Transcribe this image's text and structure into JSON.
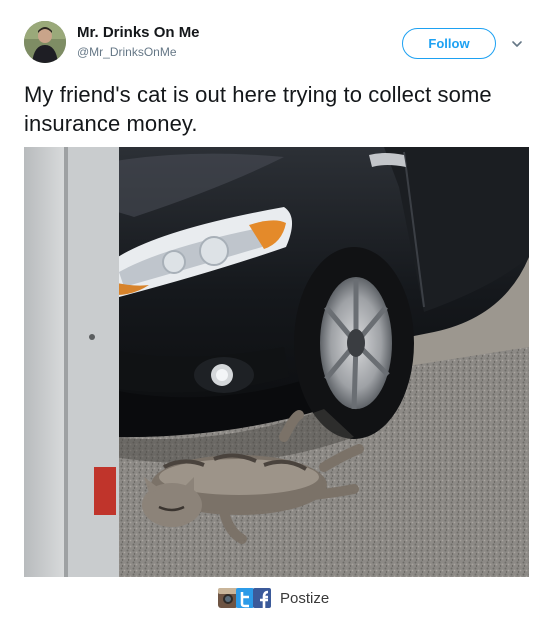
{
  "tweet": {
    "author": {
      "display_name": "Mr. Drinks On Me",
      "handle": "@Mr_DrinksOnMe",
      "avatar_icon": "avatar-photo-icon"
    },
    "follow_label": "Follow",
    "menu_icon": "chevron-down-icon",
    "text": "My friend's cat is out here trying to collect some insurance money.",
    "photo_description_icon": "cat-lying-under-car-photo"
  },
  "watermark": {
    "icons": [
      "instagram-icon",
      "twitter-icon",
      "facebook-icon"
    ],
    "brand": "Postize"
  },
  "colors": {
    "accent": "#1da1f2",
    "text_primary": "#14171a",
    "text_secondary": "#657786"
  }
}
